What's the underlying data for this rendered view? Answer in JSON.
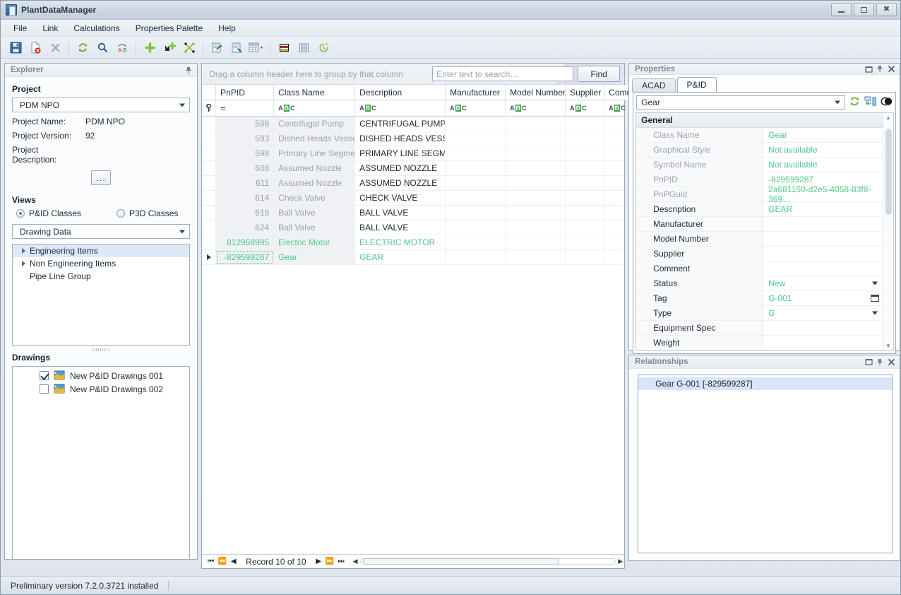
{
  "window": {
    "title": "PlantDataManager",
    "minimize_label": "Minimize",
    "maximize_label": "Maximize",
    "close_label": "Close"
  },
  "menu": [
    "File",
    "Link",
    "Calculations",
    "Properties Palette",
    "Help"
  ],
  "toolbar": [
    {
      "name": "save-icon",
      "title": "Save"
    },
    {
      "name": "delete-document-icon",
      "title": "Delete"
    },
    {
      "name": "close-x-icon",
      "title": "Close"
    },
    {
      "name": "refresh-icon",
      "title": "Refresh"
    },
    {
      "name": "search-icon",
      "title": "Search"
    },
    {
      "name": "rename-ab-icon",
      "title": "Rename"
    },
    {
      "name": "add-plus-icon",
      "title": "Add"
    },
    {
      "name": "add-node-icon",
      "title": "Add node"
    },
    {
      "name": "unlink-icon",
      "title": "Unlink"
    },
    {
      "name": "export-icon",
      "title": "Export"
    },
    {
      "name": "import-icon",
      "title": "Import"
    },
    {
      "name": "table-layout-icon",
      "title": "Table layout"
    },
    {
      "name": "report-icon",
      "title": "Report"
    },
    {
      "name": "columns-icon",
      "title": "Columns"
    },
    {
      "name": "history-icon",
      "title": "History"
    }
  ],
  "explorer": {
    "title": "Explorer",
    "project_section": "Project",
    "project_combo": "PDM NPO",
    "fields": [
      {
        "label": "Project Name:",
        "value": "PDM NPO"
      },
      {
        "label": "Project Version:",
        "value": "92"
      },
      {
        "label": "Project Description:",
        "value": ""
      }
    ],
    "browse_button": "...",
    "views_section": "Views",
    "view_options": [
      {
        "label": "P&ID Classes",
        "selected": true
      },
      {
        "label": "P3D Classes",
        "selected": false
      }
    ],
    "data_combo": "Drawing Data",
    "tree": [
      {
        "label": "Engineering Items",
        "expandable": true,
        "selected": true
      },
      {
        "label": "Non Engineering Items",
        "expandable": true,
        "selected": false
      },
      {
        "label": "Pipe Line Group",
        "expandable": false,
        "selected": false
      }
    ],
    "drawings_section": "Drawings",
    "drawings": [
      {
        "label": "New P&ID Drawings 001",
        "checked": true
      },
      {
        "label": "New P&ID Drawings 002",
        "checked": false
      }
    ]
  },
  "grid": {
    "group_hint": "Drag a column header here to group by that column",
    "search_placeholder": "Enter text to search…",
    "search_value": "",
    "find_button": "Find",
    "columns": [
      "PnPID",
      "Class Name",
      "Description",
      "Manufacturer",
      "Model Number",
      "Supplier",
      "Commen"
    ],
    "filter_row": [
      "=",
      "ABC",
      "ABC",
      "ABC",
      "ABC",
      "ABC",
      "ABC"
    ],
    "rows": [
      {
        "pnpid": "588",
        "class_name": "Centrifugal Pump",
        "description": "CENTRIFUGAL PUMP",
        "manufacturer": "",
        "model_number": "",
        "supplier": "",
        "comment": "",
        "style": "normal"
      },
      {
        "pnpid": "593",
        "class_name": "Dished Heads Vessel",
        "description": "DISHED HEADS VESSEL",
        "manufacturer": "",
        "model_number": "",
        "supplier": "",
        "comment": "",
        "style": "normal"
      },
      {
        "pnpid": "598",
        "class_name": "Primary Line Segment",
        "description": "PRIMARY LINE SEGMENT",
        "manufacturer": "",
        "model_number": "",
        "supplier": "",
        "comment": "",
        "style": "normal"
      },
      {
        "pnpid": "608",
        "class_name": "Assumed Nozzle",
        "description": "ASSUMED NOZZLE",
        "manufacturer": "",
        "model_number": "",
        "supplier": "",
        "comment": "",
        "style": "normal"
      },
      {
        "pnpid": "611",
        "class_name": "Assumed Nozzle",
        "description": "ASSUMED NOZZLE",
        "manufacturer": "",
        "model_number": "",
        "supplier": "",
        "comment": "",
        "style": "normal"
      },
      {
        "pnpid": "614",
        "class_name": "Check Valve",
        "description": "CHECK VALVE",
        "manufacturer": "",
        "model_number": "",
        "supplier": "",
        "comment": "",
        "style": "normal"
      },
      {
        "pnpid": "619",
        "class_name": "Ball Valve",
        "description": "BALL VALVE",
        "manufacturer": "",
        "model_number": "",
        "supplier": "",
        "comment": "",
        "style": "normal"
      },
      {
        "pnpid": "624",
        "class_name": "Ball Valve",
        "description": "BALL VALVE",
        "manufacturer": "",
        "model_number": "",
        "supplier": "",
        "comment": "",
        "style": "normal"
      },
      {
        "pnpid": "812958995",
        "class_name": "Electric Motor",
        "description": "ELECTRIC MOTOR",
        "manufacturer": "",
        "model_number": "",
        "supplier": "",
        "comment": "",
        "style": "green"
      },
      {
        "pnpid": "-829599287",
        "class_name": "Gear",
        "description": "GEAR",
        "manufacturer": "",
        "model_number": "",
        "supplier": "",
        "comment": "",
        "style": "green-current"
      }
    ],
    "nav": {
      "first": "⏮",
      "prev_page": "⏪",
      "prev": "◀",
      "record_text": "Record 10 of 10",
      "next": "▶",
      "next_page": "⏩",
      "last": "⏭"
    }
  },
  "properties": {
    "title": "Properties",
    "tabs": [
      {
        "label": "ACAD",
        "active": false
      },
      {
        "label": "P&ID",
        "active": true
      }
    ],
    "object_combo": "Gear",
    "tool_icons": [
      {
        "name": "refresh-icon"
      },
      {
        "name": "assign-icon"
      },
      {
        "name": "contrast-icon"
      }
    ],
    "category": "General",
    "rows": [
      {
        "name": "Class Name",
        "value": "Gear",
        "name_style": "grey",
        "value_style": "green",
        "editor": "none"
      },
      {
        "name": "Graphical Style",
        "value": "Not available",
        "name_style": "grey",
        "value_style": "green",
        "editor": "none"
      },
      {
        "name": "Symbol Name",
        "value": "Not available",
        "name_style": "grey",
        "value_style": "green",
        "editor": "none"
      },
      {
        "name": "PnPID",
        "value": "-829599287",
        "name_style": "grey",
        "value_style": "green",
        "editor": "none"
      },
      {
        "name": "PnPGuid",
        "value": "2a681150-d2e5-4058-83f8-369…",
        "name_style": "grey",
        "value_style": "green",
        "editor": "none"
      },
      {
        "name": "Description",
        "value": "GEAR",
        "name_style": "dark",
        "value_style": "green",
        "editor": "none"
      },
      {
        "name": "Manufacturer",
        "value": "",
        "name_style": "dark",
        "value_style": "green",
        "editor": "none"
      },
      {
        "name": "Model Number",
        "value": "",
        "name_style": "dark",
        "value_style": "green",
        "editor": "none"
      },
      {
        "name": "Supplier",
        "value": "",
        "name_style": "dark",
        "value_style": "green",
        "editor": "none"
      },
      {
        "name": "Comment",
        "value": "",
        "name_style": "dark",
        "value_style": "green",
        "editor": "none"
      },
      {
        "name": "Status",
        "value": "New",
        "name_style": "dark",
        "value_style": "green",
        "editor": "dropdown"
      },
      {
        "name": "Tag",
        "value": "G-001",
        "name_style": "dark",
        "value_style": "green",
        "editor": "ellipsis"
      },
      {
        "name": "Type",
        "value": "G",
        "name_style": "dark",
        "value_style": "green",
        "editor": "dropdown"
      },
      {
        "name": "Equipment Spec",
        "value": "",
        "name_style": "dark",
        "value_style": "green",
        "editor": "none"
      },
      {
        "name": "Weight",
        "value": "",
        "name_style": "dark",
        "value_style": "green",
        "editor": "none"
      }
    ]
  },
  "relationships": {
    "title": "Relationships",
    "items": [
      {
        "label": "Gear G-001 [-829599287]",
        "selected": true
      }
    ]
  },
  "statusbar": {
    "text": "Preliminary version 7.2.0.3721 installed"
  },
  "colors": {
    "accent_green": "#4fc98a",
    "selection_blue": "#d6e5f7",
    "panel_header_text": "#7b8b9b",
    "grid_grey_cell": "#eff1f4"
  }
}
